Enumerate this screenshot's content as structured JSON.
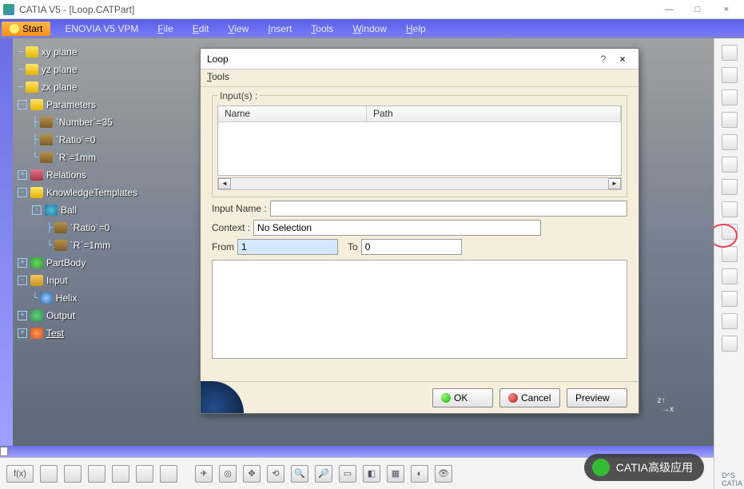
{
  "window": {
    "title": "CATIA V5 - [Loop.CATPart]"
  },
  "windowButtons": {
    "min": "—",
    "max": "□",
    "close": "×"
  },
  "menu": {
    "start": "Start",
    "items": [
      "ENOVIA V5 VPM",
      "File",
      "Edit",
      "View",
      "Insert",
      "Tools",
      "Window",
      "Help"
    ]
  },
  "tree": {
    "xy": "xy plane",
    "yz": "yz plane",
    "zx": "zx plane",
    "params": "Parameters",
    "p_number": "`Number`=35",
    "p_ratio": "`Ratio`=0",
    "p_r": "`R`=1mm",
    "relations": "Relations",
    "kt": "KnowledgeTemplates",
    "ball": "Ball",
    "b_ratio": "`Ratio`=0",
    "b_r": "`R`=1mm",
    "partbody": "PartBody",
    "input": "Input",
    "helix": "Helix",
    "output": "Output",
    "test": "Test"
  },
  "dialog": {
    "title": "Loop",
    "help": "?",
    "close": "×",
    "menu_tools": "Tools",
    "inputs_label": "Input(s) :",
    "col_name": "Name",
    "col_path": "Path",
    "input_name_label": "Input Name :",
    "input_name_value": "",
    "context_label": "Context :",
    "context_value": "No Selection",
    "from_label": "From",
    "from_value": "1",
    "to_label": "To",
    "to_value": "0",
    "ok": "OK",
    "cancel": "Cancel",
    "preview": "Preview"
  },
  "bottom": {
    "fx": "f(x)"
  },
  "wechat": "CATIA高级应用",
  "catiaLogo": "CATIA",
  "compass": {
    "z": "z",
    "x": "x"
  }
}
